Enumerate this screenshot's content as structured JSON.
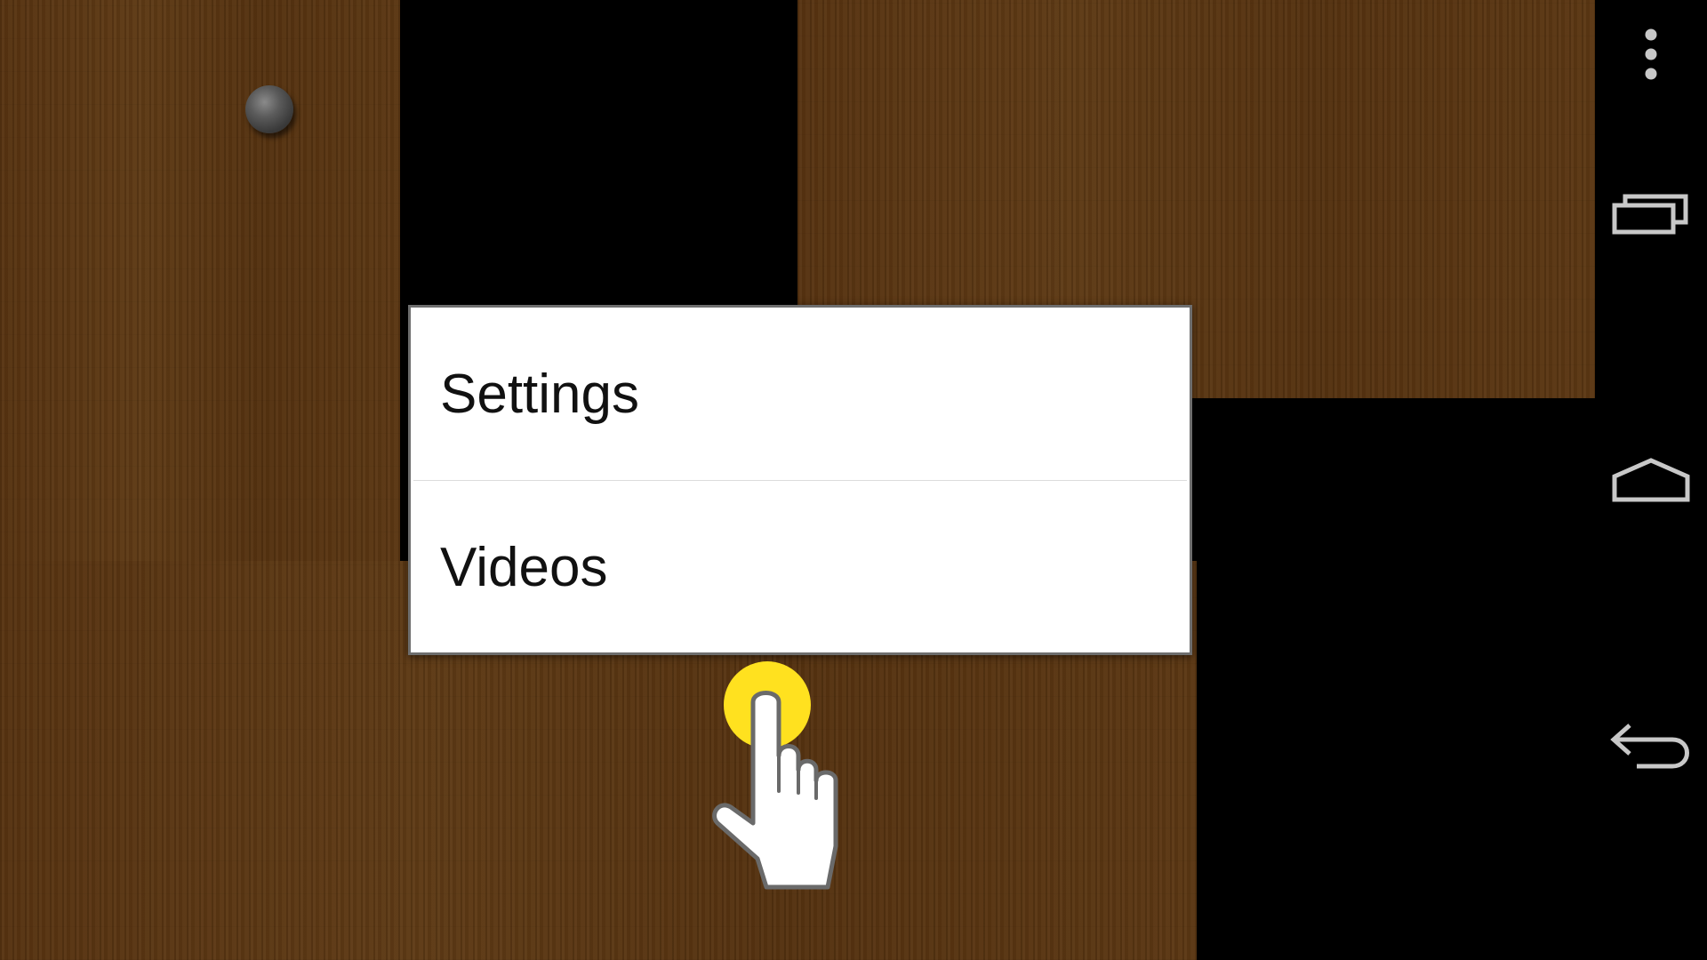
{
  "menu": {
    "items": [
      {
        "label": "Settings"
      },
      {
        "label": "Videos"
      }
    ]
  },
  "icons": {
    "overflow": "overflow-menu-icon",
    "recents": "recent-apps-icon",
    "home": "home-icon",
    "back": "back-icon",
    "tap": "tap-hand-icon"
  },
  "colors": {
    "wood": "#5a3612",
    "menu_background": "#ffffff",
    "tap_highlight": "#ffe11f",
    "nav_bar": "#000000",
    "nav_icon": "#c8c8c8"
  }
}
